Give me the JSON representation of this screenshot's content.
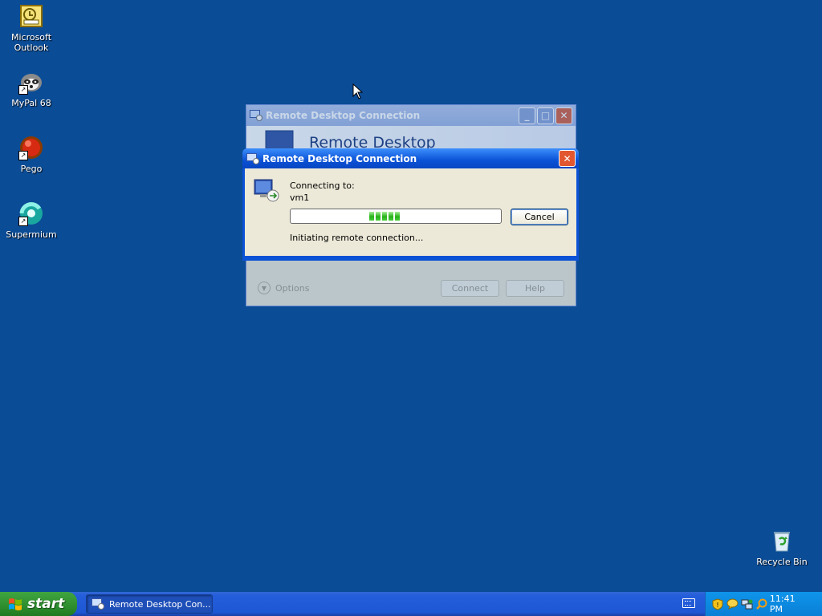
{
  "desktop": {
    "icons": [
      {
        "label": "Microsoft\nOutlook"
      },
      {
        "label": "MyPal 68"
      },
      {
        "label": "Pego"
      },
      {
        "label": "Supermium"
      },
      {
        "label": "Recycle Bin"
      }
    ]
  },
  "back_window": {
    "title": "Remote Desktop Connection",
    "banner": "Remote Desktop",
    "options_label": "Options",
    "connect_label": "Connect",
    "help_label": "Help"
  },
  "dialog": {
    "title": "Remote Desktop Connection",
    "connecting_label": "Connecting to:",
    "host": "vm1",
    "status": "Initiating remote connection...",
    "cancel_label": "Cancel",
    "progress_style": "marquee"
  },
  "taskbar": {
    "start_label": "start",
    "task_button_label": "Remote Desktop Con...",
    "clock": "11:41 PM",
    "tray_icons": [
      "security-shield-icon",
      "chat-bubble-icon",
      "network-icon",
      "search-icon"
    ]
  },
  "colors": {
    "desktop": "#0b4c96",
    "title_bar": "#0a52d6",
    "start_button": "#2e8e2e",
    "progress": "#26b219"
  }
}
